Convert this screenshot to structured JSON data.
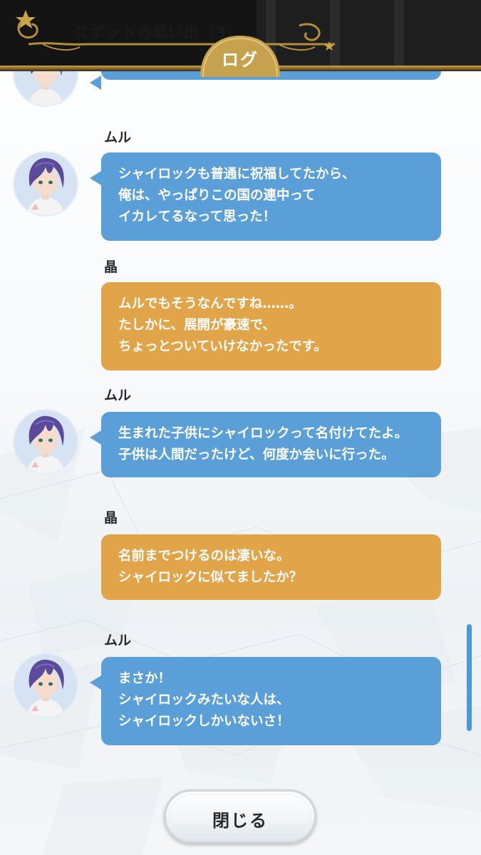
{
  "header": {
    "title": "スポットの思い出（3）",
    "tab_label": "ログ"
  },
  "messages": [
    {
      "speaker": "",
      "type": "character",
      "lines": [
        ""
      ]
    },
    {
      "speaker": "ムル",
      "type": "character",
      "lines": [
        "シャイロックも普通に祝福してたから、",
        "俺は、やっぱりこの国の連中って",
        "イカレてるなって思った！"
      ]
    },
    {
      "speaker": "晶",
      "type": "player",
      "lines": [
        "ムルでもそうなんですね……。",
        "たしかに、展開が豪速で、",
        "ちょっとついていけなかったです。"
      ]
    },
    {
      "speaker": "ムル",
      "type": "character",
      "lines": [
        "生まれた子供にシャイロックって名付けてたよ。",
        "子供は人間だったけど、何度か会いに行った。"
      ]
    },
    {
      "speaker": "晶",
      "type": "player",
      "lines": [
        "名前までつけるのは凄いな。",
        "シャイロックに似てましたか？"
      ]
    },
    {
      "speaker": "ムル",
      "type": "character",
      "lines": [
        "まさか！",
        "シャイロックみたいな人は、",
        "シャイロックしかいないさ！"
      ]
    }
  ],
  "close_button": {
    "label": "閉じる"
  },
  "colors": {
    "character_bubble": "#5b9fd8",
    "player_bubble": "#e1a448",
    "header_gold": "#c9a44a",
    "scrollbar": "#4a98e0"
  },
  "icons": {
    "avatar": "mul-avatar-icon"
  }
}
